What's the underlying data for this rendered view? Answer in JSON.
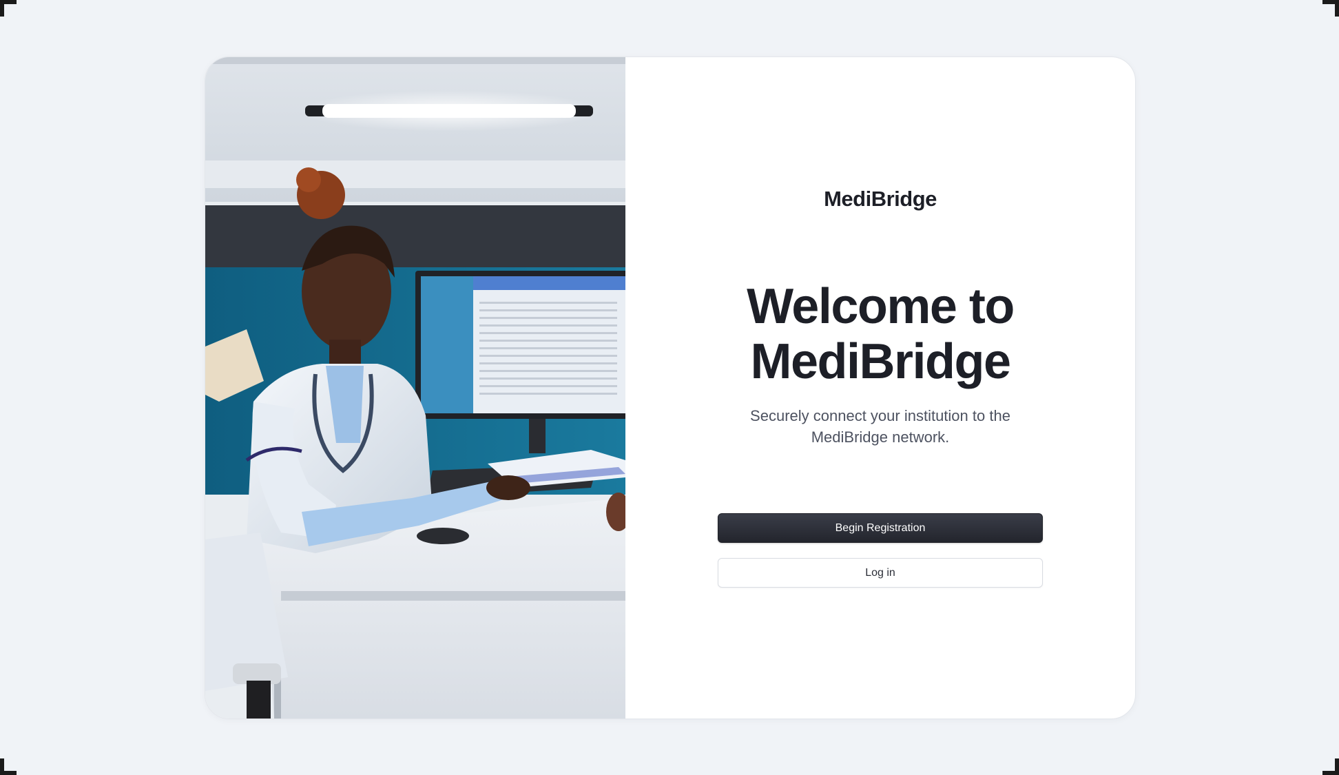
{
  "app": {
    "brand": "MediBridge"
  },
  "hero": {
    "headline_line1": "Welcome to",
    "headline_line2": "MediBridge",
    "subtitle": "Securely connect your institution to the MediBridge network."
  },
  "actions": {
    "primary_label": "Begin Registration",
    "secondary_label": "Log in"
  },
  "photo": {
    "description_icon": "doctor-at-desk-photo"
  },
  "colors": {
    "page_background": "#f0f3f7",
    "card_background": "#ffffff",
    "primary_button": "#23252d",
    "text_dark": "#1d1f27",
    "text_muted": "#4d5260"
  }
}
